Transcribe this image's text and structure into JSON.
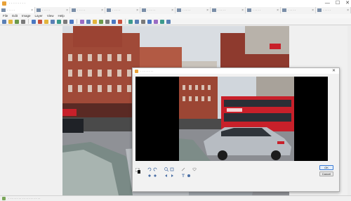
{
  "window": {
    "title": "· · · ·  ·  ·   · ·",
    "controls": {
      "minimize": "—",
      "maximize": "☐",
      "close": "✕"
    }
  },
  "tabs": [
    {
      "label": "· · · · ·",
      "active": true
    },
    {
      "label": "· · · · ·",
      "active": false
    },
    {
      "label": "· · · · ·",
      "active": false
    },
    {
      "label": "· · · · ·",
      "active": false
    },
    {
      "label": "· · · · ·",
      "active": false
    },
    {
      "label": "· · · · ·",
      "active": false
    },
    {
      "label": "· · · · ·",
      "active": false
    },
    {
      "label": "· · · · ·",
      "active": false
    },
    {
      "label": "· · · · ·",
      "active": false
    },
    {
      "label": "· · · · ·",
      "active": false
    }
  ],
  "menu": [
    "File",
    "Edit",
    "Image",
    "Layer",
    "View",
    "Help"
  ],
  "toolbar_colors": [
    "#5a7fb5",
    "#e2b43c",
    "#6c9a4b",
    "#7a7a7a",
    "#4a78c2",
    "#c8503c",
    "#e2b43c",
    "#5a7fb5",
    "#3c9a8c",
    "#7a7a7a",
    "#4a78c2",
    "#9a6cc4",
    "#5a7fb5",
    "#e2b43c",
    "#6c9a4b",
    "#7a7a7a",
    "#4a78c2",
    "#c8503c",
    "#3c9a8c",
    "#5a7fb5",
    "#7a7a7a",
    "#4a78c2",
    "#9a6cc4",
    "#3c9a8c",
    "#5a7fb5"
  ],
  "status": {
    "text": "·  · · · · · ·   · · · ·   · · · · · · · ·"
  },
  "dialog": {
    "title": "· · · · · · · ·",
    "close": "✕",
    "ok_label": "OK",
    "cancel_label": "Cancel"
  },
  "colors": {
    "dialog_border": "#b0b0b0",
    "ok_accent": "#3a7bd5",
    "bus_red": "#c8202a",
    "app_icon": "#e8a23a"
  }
}
